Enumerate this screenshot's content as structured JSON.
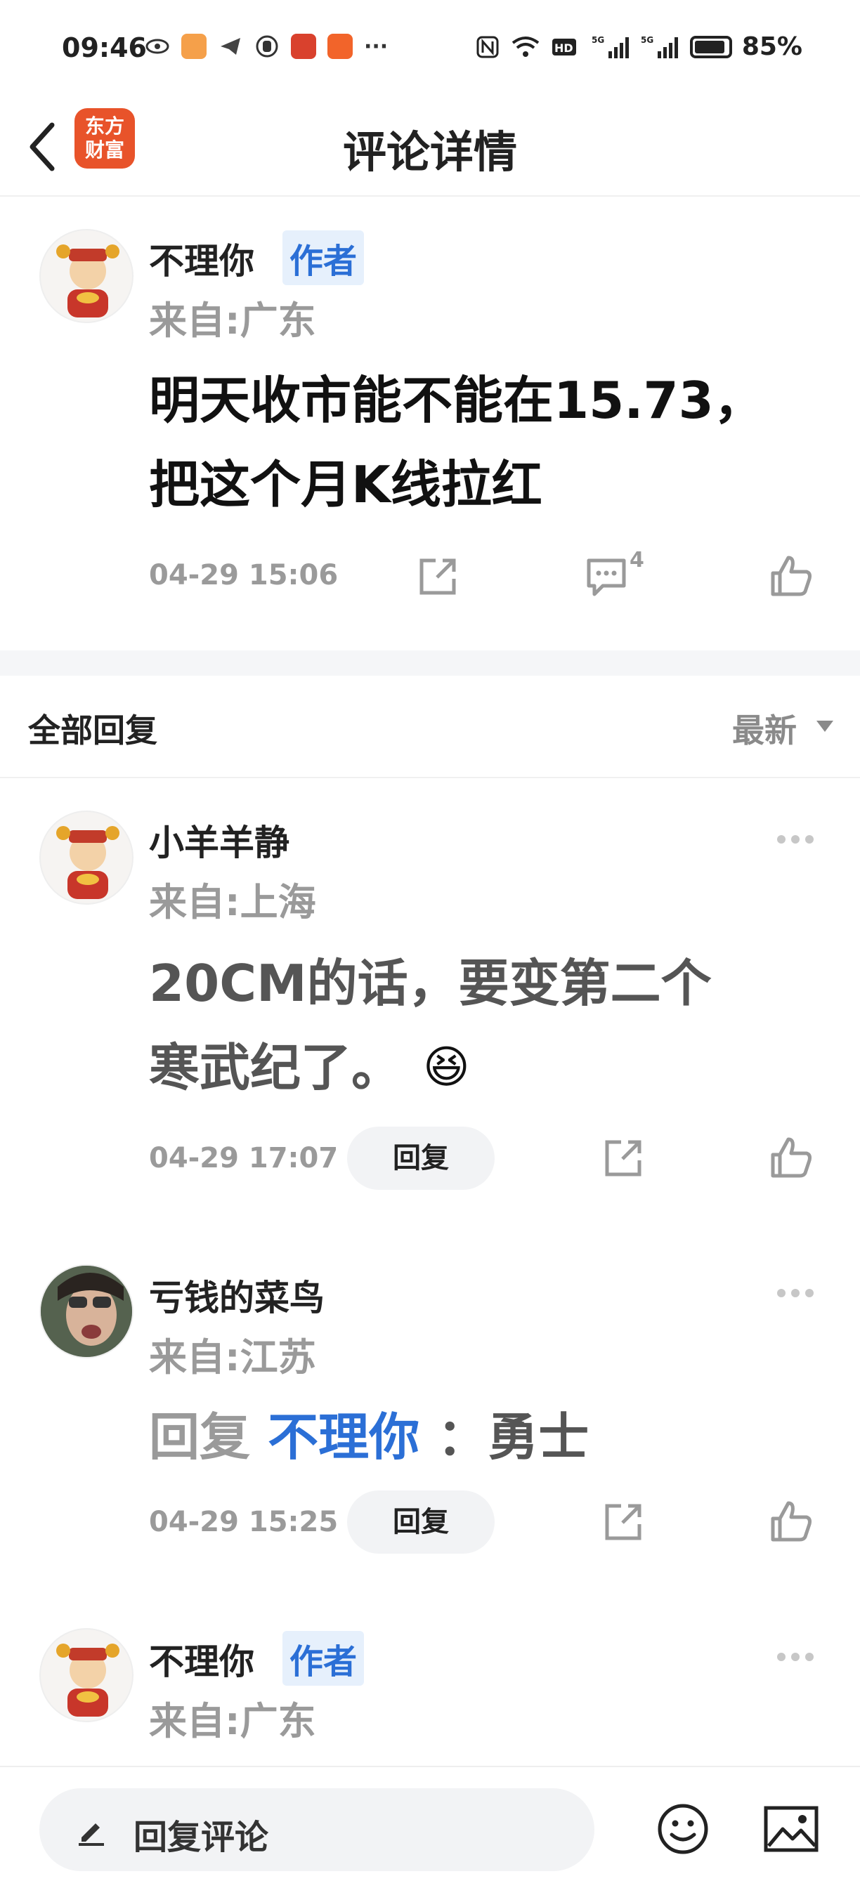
{
  "status_bar": {
    "time": "09:46",
    "battery": "85%",
    "network": "5G"
  },
  "header": {
    "title": "评论详情",
    "logo_line1": "东方",
    "logo_line2": "财富"
  },
  "main_comment": {
    "author": "不理你",
    "author_tag": "作者",
    "location": "来自:广东",
    "text_line1": "明天收市能不能在15.73，",
    "text_line2": "把这个月K线拉红",
    "time": "04-29 15:06",
    "comment_count": "4"
  },
  "replies_section": {
    "title": "全部回复",
    "sort_label": "最新"
  },
  "replies": [
    {
      "author": "小羊羊静",
      "location": "来自:上海",
      "text_line1": "20CM的话，要变第二个",
      "text_line2": "寒武纪了。",
      "emoji": "😆",
      "time": "04-29 17:07",
      "reply_label": "回复"
    },
    {
      "author": "亏钱的菜鸟",
      "location": "来自:江苏",
      "reply_prefix": "回复",
      "reply_target": "不理你",
      "reply_text": "：勇士",
      "time": "04-29 15:25",
      "reply_label": "回复"
    },
    {
      "author": "不理你",
      "author_tag": "作者",
      "location": "来自:广东"
    }
  ],
  "bottom_bar": {
    "input_placeholder": "回复评论"
  },
  "colors": {
    "brand": "#e8532a",
    "link_blue": "#2b6fd6",
    "muted": "#9a9a9a"
  }
}
